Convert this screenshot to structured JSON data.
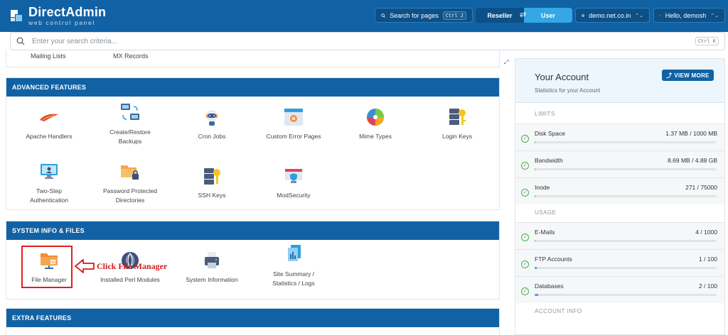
{
  "header": {
    "brand": "DirectAdmin",
    "brand_sub": "web control panel",
    "search_pages": "Search for pages",
    "search_pages_kbd": "Ctrl J",
    "mode_reseller": "Reseller",
    "mode_user": "User",
    "domain": "demo.net.co.in",
    "greeting": "Hello, demosh"
  },
  "search": {
    "placeholder": "Enter your search criteria...",
    "kbd": "Ctrl K"
  },
  "email_section_tail": {
    "items": [
      "Mailing Lists",
      "MX Records"
    ]
  },
  "advanced_features": {
    "title": "ADVANCED FEATURES",
    "items": [
      {
        "label": "Apache Handlers",
        "icon": "apache-feather-icon"
      },
      {
        "label": "Create/Restore Backups",
        "icon": "backup-computers-icon"
      },
      {
        "label": "Cron Jobs",
        "icon": "robot-icon"
      },
      {
        "label": "Custom Error Pages",
        "icon": "error-page-icon"
      },
      {
        "label": "Mime Types",
        "icon": "mime-icon"
      },
      {
        "label": "Login Keys",
        "icon": "server-key-icon"
      },
      {
        "label": "Two-Step Authentication",
        "icon": "monitor-user-icon"
      },
      {
        "label": "Password Protected Directories",
        "icon": "locked-folder-icon"
      },
      {
        "label": "SSH Keys",
        "icon": "ssh-key-icon"
      },
      {
        "label": "ModSecurity",
        "icon": "shield-monitor-icon"
      }
    ]
  },
  "system_info": {
    "title": "SYSTEM INFO & FILES",
    "items": [
      {
        "label": "File Manager",
        "icon": "folder-icon"
      },
      {
        "label": "Installed Perl Modules",
        "icon": "perl-onion-icon"
      },
      {
        "label": "System Information",
        "icon": "printer-icon"
      },
      {
        "label": "Site Summary / Statistics / Logs",
        "icon": "documents-icon"
      }
    ]
  },
  "extra_features": {
    "title": "EXTRA FEATURES"
  },
  "annotation": {
    "text": "Click File Manager",
    "color": "#d21c1c"
  },
  "account": {
    "title": "Your Account",
    "subtitle": "Statistics for your Account",
    "view_more": "VIEW MORE",
    "limits_label": "LIMITS",
    "usage_label": "USAGE",
    "account_info_label": "ACCOUNT INFO",
    "limits": [
      {
        "name": "Disk Space",
        "value": "1.37 MB / 1000 MB",
        "fraction": 0.0014
      },
      {
        "name": "Bandwidth",
        "value": "8.69 MB / 4.88 GB",
        "fraction": 0.0017
      },
      {
        "name": "Inode",
        "value": "271 / 75000",
        "fraction": 0.0036
      }
    ],
    "usage": [
      {
        "name": "E-Mails",
        "value": "4 / 1000",
        "fraction": 0.004
      },
      {
        "name": "FTP Accounts",
        "value": "1 / 100",
        "fraction": 0.01
      },
      {
        "name": "Databases",
        "value": "2 / 100",
        "fraction": 0.02
      }
    ]
  },
  "colors": {
    "brand": "#1162a4",
    "accent": "#35a7e5",
    "ok": "#4caf50"
  }
}
